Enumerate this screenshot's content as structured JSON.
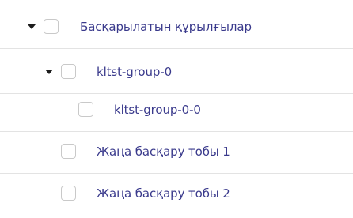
{
  "tree": {
    "items": [
      {
        "label": "Басқарылатын құрылғылар",
        "expanded": true,
        "checked": false
      },
      {
        "label": "kltst-group-0",
        "expanded": true,
        "checked": false
      },
      {
        "label": "kltst-group-0-0",
        "checked": false
      },
      {
        "label": "Жаңа басқару тобы 1",
        "checked": false
      },
      {
        "label": "Жаңа басқару тобы 2",
        "checked": false
      }
    ]
  },
  "colors": {
    "label": "#3a3a8c",
    "divider": "#e3e3e3",
    "checkbox_border": "#c9c9c9",
    "caret": "#1c1c1c"
  }
}
